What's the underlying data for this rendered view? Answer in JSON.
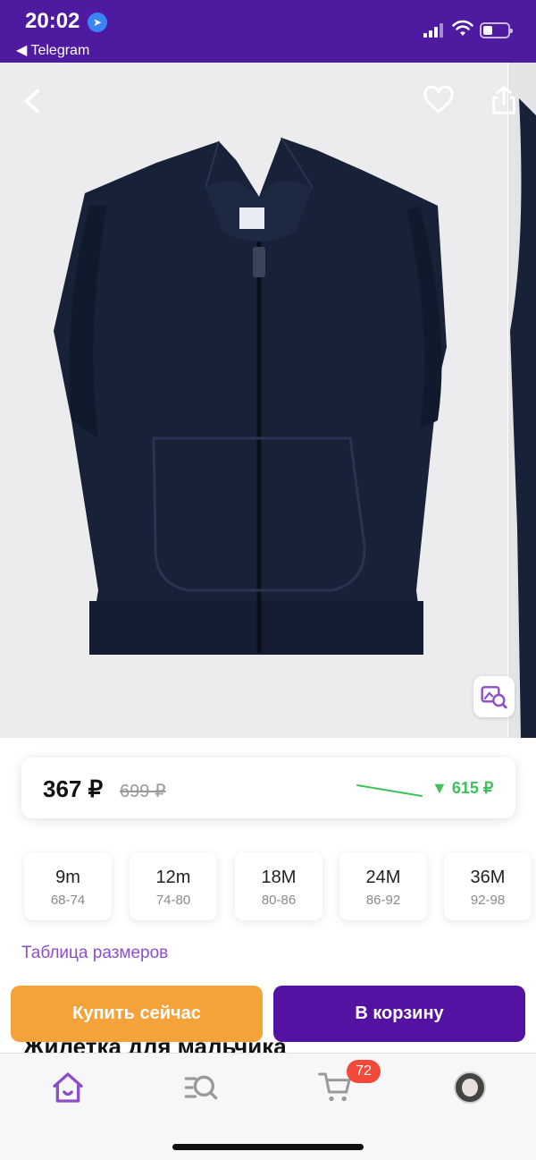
{
  "status_bar": {
    "time": "20:02",
    "back_app": "◀ Telegram"
  },
  "gallery": {
    "back_icon": "chevron-left-icon",
    "favorite_icon": "heart-outline-icon",
    "share_icon": "share-icon",
    "image_search_icon": "image-search-icon",
    "product_image": "navy-hooded-vest"
  },
  "price": {
    "current": "367 ₽",
    "old": "699 ₽",
    "drop": "▼ 615 ₽",
    "drop_color": "#3cc15d"
  },
  "sizes": [
    {
      "label": "9m",
      "range": "68-74"
    },
    {
      "label": "12m",
      "range": "74-80"
    },
    {
      "label": "18M",
      "range": "80-86"
    },
    {
      "label": "24M",
      "range": "86-92"
    },
    {
      "label": "36M",
      "range": "92-98"
    }
  ],
  "size_table_link": "Таблица размеров",
  "product_title": "Жилетка для мальчика",
  "actions": {
    "buy_now": "Купить сейчас",
    "add_to_cart": "В корзину",
    "buy_color": "#f4a33a",
    "cart_color": "#5312a1"
  },
  "tabbar": {
    "home_icon": "home-icon",
    "catalog_icon": "search-list-icon",
    "cart_icon": "cart-icon",
    "cart_count": "72",
    "profile_icon": "avatar",
    "accent_color": "#8d4fc9"
  }
}
